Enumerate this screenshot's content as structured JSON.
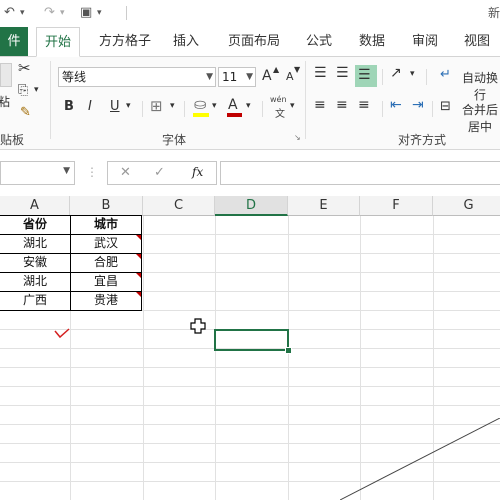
{
  "window": {
    "title_fragment": "新"
  },
  "tabs": [
    "件",
    "开始",
    "方方格子",
    "插入",
    "页面布局",
    "公式",
    "数据",
    "审阅",
    "视图"
  ],
  "ribbon": {
    "font_name": "等线",
    "font_size": "11",
    "grow_font": "A",
    "shrink_font": "A",
    "bold": "B",
    "italic": "I",
    "underline": "U",
    "phonetic_label": "wén",
    "phonetic_char": "文",
    "wrap_text": "自动换行",
    "merge_center": "合并后居中",
    "group_clipboard": "贴板",
    "group_font": "字体",
    "group_alignment": "对齐方式",
    "paste_fragment": "粘"
  },
  "formula_bar": {
    "cancel": "✕",
    "enter": "✓",
    "fx": "fx",
    "value": ""
  },
  "columns": [
    "A",
    "B",
    "C",
    "D",
    "E",
    "F",
    "G"
  ],
  "selected_column": "D",
  "table": {
    "headers": [
      "省份",
      "城市"
    ],
    "rows": [
      [
        "湖北",
        "武汉"
      ],
      [
        "安徽",
        "合肥"
      ],
      [
        "湖北",
        "宜昌"
      ],
      [
        "广西",
        "贵港"
      ]
    ]
  },
  "colors": {
    "excel_green": "#217346",
    "comment_red": "#c00000"
  }
}
